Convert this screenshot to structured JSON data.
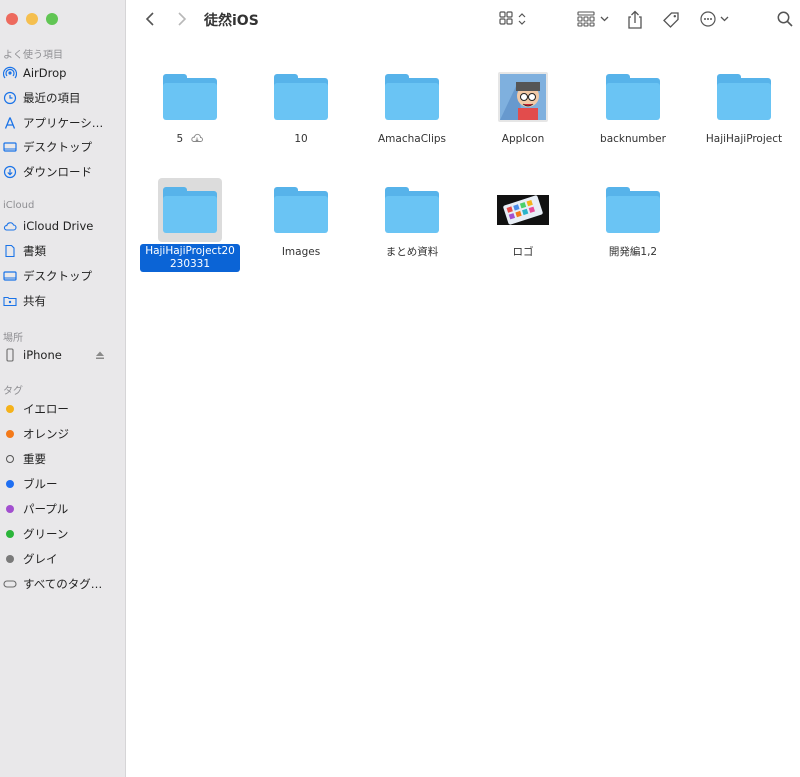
{
  "window": {
    "title": "徒然iOS"
  },
  "sidebar": {
    "favorites": {
      "header": "よく使う項目",
      "items": [
        {
          "label": "AirDrop",
          "icon": "airdrop-icon"
        },
        {
          "label": "最近の項目",
          "icon": "clock-icon"
        },
        {
          "label": "アプリケーシ…",
          "icon": "applications-icon"
        },
        {
          "label": "デスクトップ",
          "icon": "desktop-icon"
        },
        {
          "label": "ダウンロード",
          "icon": "download-icon"
        }
      ]
    },
    "icloud": {
      "header": "iCloud",
      "items": [
        {
          "label": "iCloud Drive",
          "icon": "cloud-icon"
        },
        {
          "label": "書類",
          "icon": "document-icon"
        },
        {
          "label": "デスクトップ",
          "icon": "desktop-icon"
        },
        {
          "label": "共有",
          "icon": "shared-folder-icon"
        }
      ]
    },
    "locations": {
      "header": "場所",
      "items": [
        {
          "label": "iPhone",
          "icon": "iphone-icon"
        }
      ]
    },
    "tags": {
      "header": "タグ",
      "items": [
        {
          "label": "イエロー",
          "color": "#f5b21a"
        },
        {
          "label": "オレンジ",
          "color": "#f47a1a"
        },
        {
          "label": "重要",
          "color": "none"
        },
        {
          "label": "ブルー",
          "color": "#1f6ff2"
        },
        {
          "label": "パープル",
          "color": "#a24fcf"
        },
        {
          "label": "グリーン",
          "color": "#2bb53a"
        },
        {
          "label": "グレイ",
          "color": "#7a7a7a"
        },
        {
          "label": "すべてのタグ…",
          "color": "all"
        }
      ]
    }
  },
  "files": [
    {
      "name": "5",
      "type": "folder",
      "cloud": true
    },
    {
      "name": "10",
      "type": "folder"
    },
    {
      "name": "AmachaClips",
      "type": "folder"
    },
    {
      "name": "AppIcon",
      "type": "image"
    },
    {
      "name": "backnumber",
      "type": "folder"
    },
    {
      "name": "HajiHajiProject",
      "type": "folder"
    },
    {
      "name": "HajiHajiProject20230331",
      "type": "folder",
      "selected": true
    },
    {
      "name": "Images",
      "type": "folder"
    },
    {
      "name": "まとめ資料",
      "type": "folder"
    },
    {
      "name": "ロゴ",
      "type": "image"
    },
    {
      "name": "開発編1,2",
      "type": "folder"
    }
  ],
  "colors": {
    "folder": "#6ac4f4",
    "selection": "#0b64d6",
    "sidebar": "#e9e8ea"
  }
}
